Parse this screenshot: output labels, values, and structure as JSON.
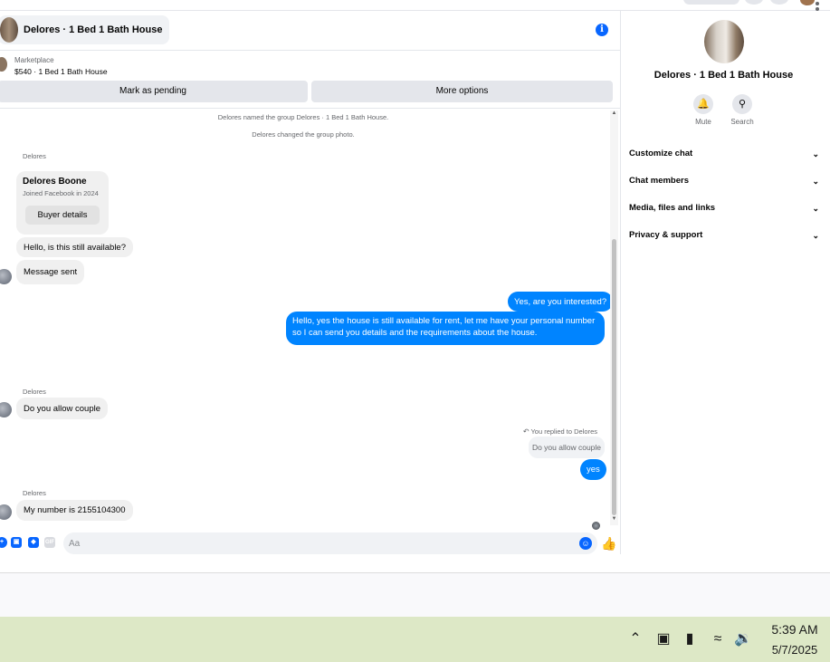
{
  "conversation": {
    "title": "Delores · 1 Bed 1 Bath House",
    "marketplace_label": "Marketplace",
    "listing": "$540 · 1 Bed 1 Bath House",
    "mark_pending_label": "Mark as pending",
    "more_options_label": "More options"
  },
  "messages": {
    "sys_rename": "Delores named the group Delores · 1 Bed 1 Bath House.",
    "sys_photo": "Delores changed the group photo.",
    "sender_name": "Delores",
    "buyer_name": "Delores Boone",
    "buyer_joined": "Joined Facebook in 2024",
    "buyer_details_label": "Buyer details",
    "m1": "Hello, is this still available?",
    "m2": "Message sent",
    "m3": "Yes, are you interested?",
    "m4": "Hello, yes the house is still available for rent, let me have your personal number so I can send you details and the requirements about the house.",
    "m5": "Do you allow couple",
    "reply_label": "You replied to Delores",
    "quoted": "Do you allow couple",
    "m6": "yes",
    "m7": "My number is 2155104300"
  },
  "composer": {
    "placeholder": "Aa"
  },
  "panel": {
    "title": "Delores · 1 Bed 1 Bath House",
    "mute_label": "Mute",
    "search_label": "Search",
    "items": [
      {
        "label": "Customize chat"
      },
      {
        "label": "Chat members"
      },
      {
        "label": "Media, files and links"
      },
      {
        "label": "Privacy & support"
      }
    ]
  },
  "taskbar": {
    "time": "5:39 AM",
    "date": "5/7/2025"
  },
  "colors": {
    "accent": "#0084ff",
    "brand": "#0866ff",
    "taskbar": "#dde8c6"
  },
  "icons": [
    "info-icon",
    "bell-icon",
    "search-icon",
    "chevron-down-icon",
    "emoji-icon",
    "like-icon",
    "image-icon",
    "sticker-icon",
    "gif-icon",
    "plus-icon",
    "wifi-icon",
    "battery-icon",
    "volume-icon",
    "reply-arrow-icon"
  ]
}
